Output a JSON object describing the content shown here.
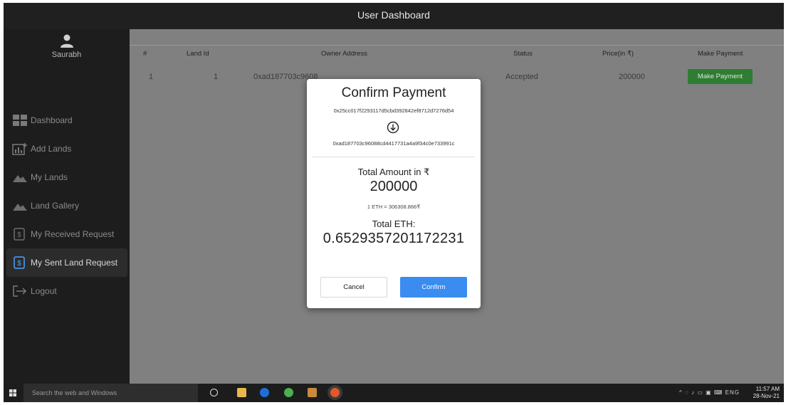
{
  "header": {
    "title": "User Dashboard"
  },
  "sidebar": {
    "user_name": "Saurabh",
    "items": [
      {
        "label": "Dashboard",
        "icon": "dashboard-icon"
      },
      {
        "label": "Add Lands",
        "icon": "add-chart-icon"
      },
      {
        "label": "My Lands",
        "icon": "landscape-icon"
      },
      {
        "label": "Land Gallery",
        "icon": "landscape-icon"
      },
      {
        "label": "My Received Request",
        "icon": "dollar-doc-icon"
      },
      {
        "label": "My Sent Land Request",
        "icon": "dollar-doc-icon",
        "active": true
      },
      {
        "label": "Logout",
        "icon": "logout-icon"
      }
    ]
  },
  "table": {
    "headers": [
      "#",
      "Land Id",
      "Owner Address",
      "Status",
      "Price(in ₹)",
      "Make Payment"
    ],
    "rows": [
      {
        "index": "1",
        "land_id": "1",
        "owner_address": "0xad187703c96088cd4417731a4a9f34c0e733991c",
        "status": "Accepted",
        "price": "200000",
        "action": "Make Payment"
      }
    ]
  },
  "modal": {
    "title": "Confirm Payment",
    "from_address": "0x25cc017f2293117d5cbd392842ef8712d7276d54",
    "to_address": "0xad187703c96088cd4417731a4a9f34c0e733991c",
    "amount_label": "Total Amount in ₹",
    "amount": "200000",
    "rate": "1 ETH = 306308.866₹",
    "eth_label": "Total ETH:",
    "eth_amount": "0.6529357201172231",
    "cancel_label": "Cancel",
    "confirm_label": "Confirm"
  },
  "taskbar": {
    "search_placeholder": "Search the web and Windows",
    "lang": "ENG",
    "time": "11:57 AM",
    "date": "28-Nov-21"
  },
  "colors": {
    "accent": "#3a8cf0",
    "pay_button": "#2e7d32",
    "topbar": "#202020",
    "sidebar": "#1d1d1d"
  }
}
